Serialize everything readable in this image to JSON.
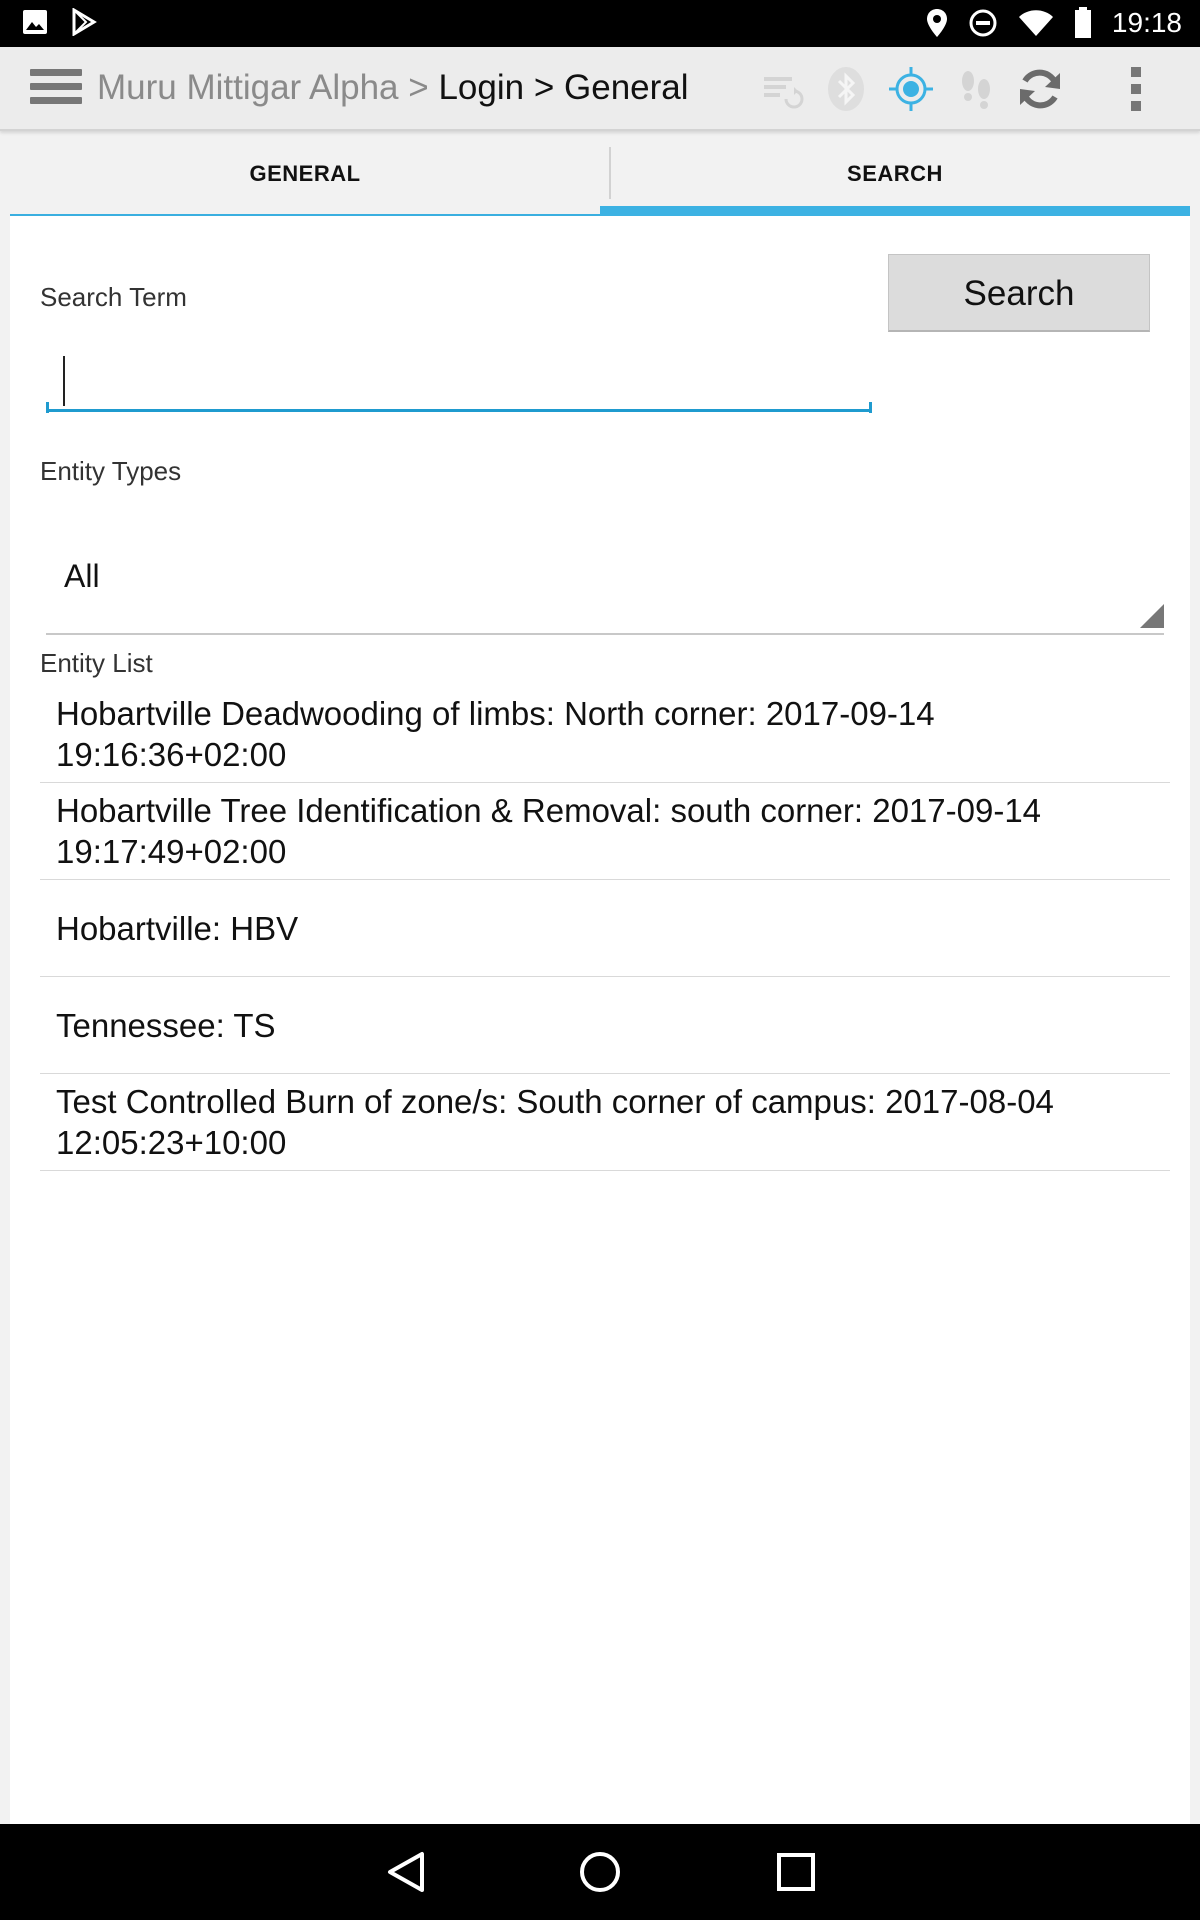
{
  "status_bar": {
    "time": "19:18",
    "icons": [
      "gallery-icon",
      "play-store-icon",
      "location-icon",
      "do-not-disturb-icon",
      "wifi-icon",
      "battery-icon"
    ]
  },
  "action_bar": {
    "breadcrumb": {
      "app": "Muru Mittigar Alpha",
      "separator": ">",
      "items": [
        "Login",
        "General"
      ]
    },
    "icons": [
      "sync-queue-icon",
      "bluetooth-icon",
      "gps-target-icon",
      "footsteps-icon",
      "refresh-icon",
      "overflow-menu-icon"
    ],
    "accent_color": "#3cb2e3"
  },
  "tabs": [
    {
      "label": "GENERAL",
      "selected": false
    },
    {
      "label": "SEARCH",
      "selected": true
    }
  ],
  "search": {
    "term_label": "Search Term",
    "term_value": "",
    "button_label": "Search",
    "entity_types_label": "Entity Types",
    "entity_types_selected": "All",
    "entity_list_label": "Entity List",
    "entities": [
      "Hobartville Deadwooding of limbs: North corner: 2017-09-14 19:16:36+02:00",
      "Hobartville Tree Identification & Removal: south corner: 2017-09-14 19:17:49+02:00",
      "Hobartville: HBV",
      "Tennessee: TS",
      "Test Controlled Burn of zone/s: South corner of campus: 2017-08-04 12:05:23+10:00"
    ]
  },
  "nav_bar": {
    "icons": [
      "back-icon",
      "home-icon",
      "recents-icon"
    ]
  }
}
